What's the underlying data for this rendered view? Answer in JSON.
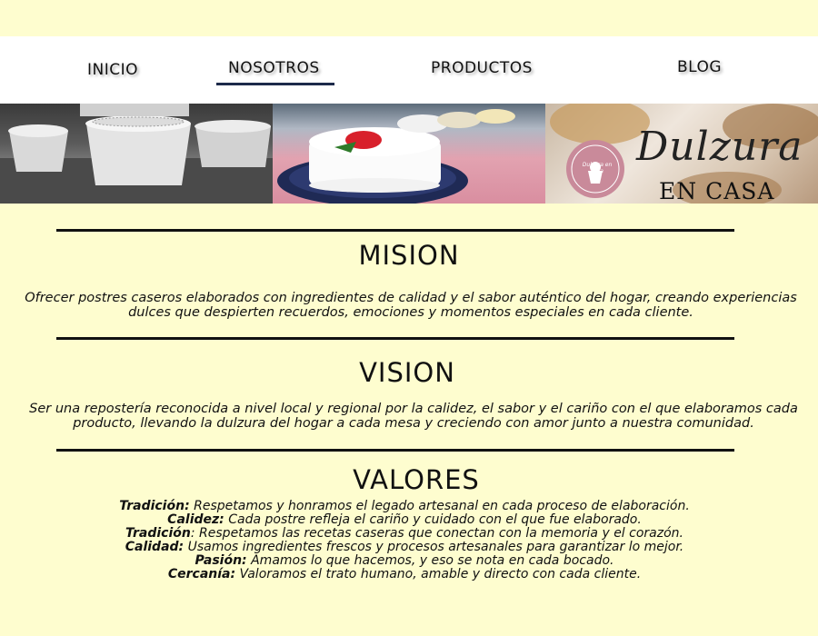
{
  "nav": {
    "items": [
      {
        "label": "INICIO"
      },
      {
        "label": "NOSOTROS"
      },
      {
        "label": "PRODUCTOS"
      },
      {
        "label": "BLOG"
      }
    ],
    "active": "NOSOTROS"
  },
  "banner": {
    "logo_script": "Dulzura",
    "logo_sub": "EN CASA",
    "badge_text": "Dulzura en casa"
  },
  "mision": {
    "title": "MISION",
    "text": "Ofrecer postres caseros elaborados con ingredientes de calidad y el sabor auténtico del hogar, creando experiencias dulces que despierten recuerdos, emociones y momentos especiales en cada cliente."
  },
  "vision": {
    "title": "VISION",
    "text": "Ser una repostería reconocida a nivel local y regional por la calidez, el sabor y el cariño con el que elaboramos cada producto, llevando la dulzura del hogar a cada mesa y creciendo con amor junto a nuestra comunidad."
  },
  "valores": {
    "title": "VALORES",
    "items": [
      {
        "name": "Tradición:",
        "text": " Respetamos y honramos el legado artesanal en cada proceso de elaboración."
      },
      {
        "name": "Calidez:",
        "text": " Cada postre refleja el cariño y cuidado con el que fue elaborado."
      },
      {
        "name": "Tradición",
        "text": ": Respetamos las recetas caseras que conectan con la memoria y el corazón."
      },
      {
        "name": "Calidad:",
        "text": " Usamos ingredientes frescos y procesos artesanales para garantizar lo mejor."
      },
      {
        "name": "Pasión:",
        "text": " Amamos lo que hacemos, y eso se nota en cada bocado."
      },
      {
        "name": "Cercanía:",
        "text": " Valoramos el trato humano, amable y directo con cada cliente."
      }
    ]
  },
  "colors": {
    "background": "#fefdcf",
    "nav_background": "#ffffff",
    "active_underline": "#1d2a4a"
  }
}
